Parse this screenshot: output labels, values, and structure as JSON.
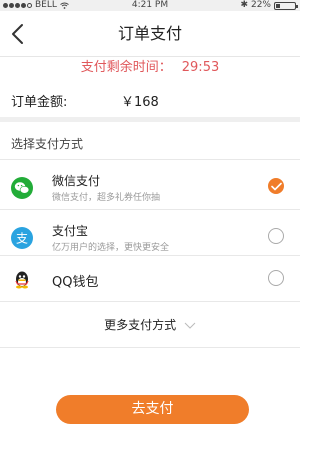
{
  "status_bar": {
    "carrier": "BELL",
    "time": "4:21 PM",
    "battery": "22%"
  },
  "nav": {
    "title": "订单支付"
  },
  "countdown": {
    "label": "支付剩余时间：",
    "value": "29:53"
  },
  "order": {
    "amount_label": "订单金额:",
    "amount_value": "￥168"
  },
  "payment": {
    "section_title": "选择支付方式",
    "methods": [
      {
        "name": "微信支付",
        "desc": "微信支付，超多礼券任你抽",
        "selected": true,
        "icon": "wechat-pay-icon"
      },
      {
        "name": "支付宝",
        "desc": "亿万用户的选择，更快更安全",
        "selected": false,
        "icon": "alipay-icon"
      },
      {
        "name": "QQ钱包",
        "desc": "",
        "selected": false,
        "icon": "qq-wallet-icon"
      }
    ],
    "more_label": "更多支付方式"
  },
  "action": {
    "pay_label": "去支付"
  },
  "colors": {
    "accent": "#f07d2a",
    "countdown": "#e0585b",
    "wechat": "#22ac38",
    "alipay": "#2aa3e0"
  }
}
